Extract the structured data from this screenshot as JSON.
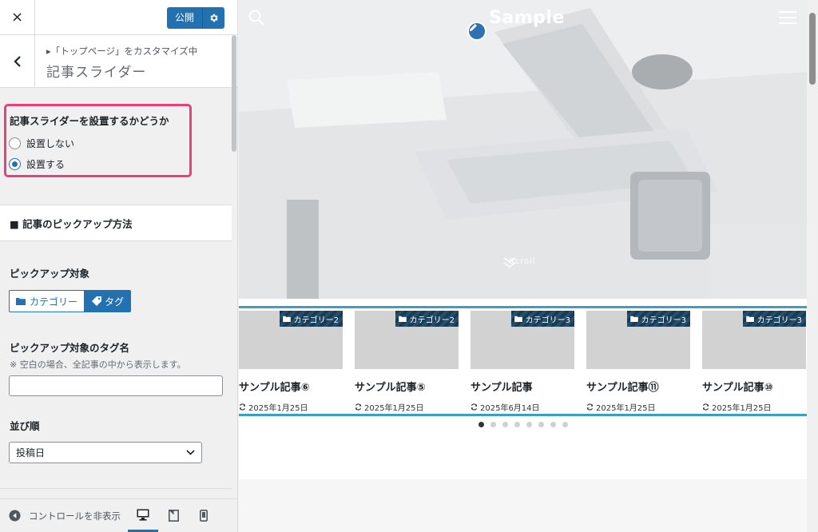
{
  "customizer": {
    "close_label": "×",
    "publish_label": "公開",
    "customizing_label": "▸「トップページ」をカスタマイズ中",
    "section_title": "記事スライダー",
    "slider_question": "記事スライダーを設置するかどうか",
    "radio_options": [
      {
        "label": "設置しない",
        "checked": false
      },
      {
        "label": "設置する",
        "checked": true
      }
    ],
    "pickup_section_title": "■ 記事のピックアップ方法",
    "pickup_target_label": "ピックアップ対象",
    "pickup_toggle": {
      "category_label": "カテゴリー",
      "tag_label": "タグ",
      "selected": "tag"
    },
    "tag_name_label": "ピックアップ対象のタグ名",
    "tag_name_note": "※ 空白の場合、全記事の中から表示します。",
    "tag_name_value": "",
    "order_label": "並び順",
    "order_value": "投稿日",
    "hide_controls_label": "コントロールを非表示"
  },
  "preview": {
    "site_title": "Sample",
    "scroll_label": "Scroll",
    "cards": [
      {
        "category": "カテゴリー2",
        "title": "サンプル記事⑥",
        "date": "2025年1月25日"
      },
      {
        "category": "カテゴリー2",
        "title": "サンプル記事⑤",
        "date": "2025年1月25日"
      },
      {
        "category": "カテゴリー3",
        "title": "サンプル記事",
        "date": "2025年6月14日"
      },
      {
        "category": "カテゴリー3",
        "title": "サンプル記事⑪",
        "date": "2025年1月25日"
      },
      {
        "category": "カテゴリー3",
        "title": "サンプル記事⑩",
        "date": "2025年1月25日"
      }
    ],
    "pagination_count": 8,
    "pagination_active": 0
  },
  "icons": [
    "close-icon",
    "gear-icon",
    "chevron-left-icon",
    "folder-icon",
    "tag-icon",
    "chevron-down-icon",
    "arrow-left-circle-icon",
    "desktop-icon",
    "tablet-icon",
    "mobile-icon",
    "search-icon",
    "pencil-icon",
    "hamburger-icon",
    "double-chevron-down-icon",
    "refresh-icon"
  ],
  "colors": {
    "accent": "#2271b1",
    "highlight_pink": "#e8407a",
    "highlight_blue": "#3aa0c2",
    "badge": "#1b3b53"
  }
}
